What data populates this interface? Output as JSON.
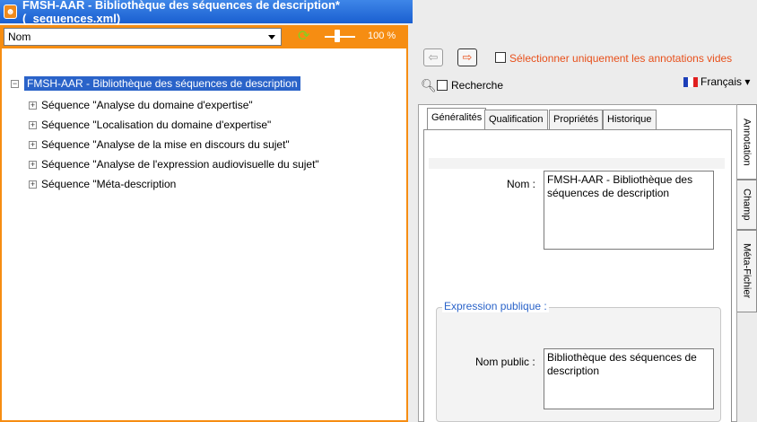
{
  "window": {
    "title": "FMSH-AAR - Bibliothèque des séquences de description* (_sequences.xml)",
    "app_icon": "cat-face-icon"
  },
  "left_toolbar": {
    "sort_select_value": "Nom",
    "refresh_icon": "refresh-icon",
    "zoom_label": "100 %",
    "zoom_fraction": 0.5
  },
  "tree": {
    "root": "FMSH-AAR - Bibliothèque des séquences de description",
    "items": [
      "Séquence \"Analyse du domaine d'expertise\"",
      "Séquence \"Localisation du domaine d'expertise\"",
      "Séquence \"Analyse de la mise en discours du sujet\"",
      "Séquence \"Analyse de l'expression audiovisuelle du sujet\"",
      "Séquence \"Méta-description"
    ]
  },
  "right_toolbar": {
    "back_icon": "arrow-left-icon",
    "forward_icon": "arrow-right-icon",
    "empty_only_label": "Sélectionner uniquement les annotations vides",
    "search_label": "Recherche",
    "language": "Français"
  },
  "tabs": [
    "Généralités",
    "Qualification",
    "Propriétés",
    "Historique"
  ],
  "side_tabs": [
    "Annotation",
    "Champ",
    "Méta-Fichier"
  ],
  "form": {
    "name_label": "Nom :",
    "name_value": "FMSH-AAR - Bibliothèque des séquences de description",
    "public_group_label": "Expression publique :",
    "public_name_label": "Nom public :",
    "public_name_value": "Bibliothèque des séquences de description"
  },
  "colors": {
    "accent": "#f68d12",
    "title_bar": "#2a6ee0",
    "selection": "#2a63c9",
    "warning_text": "#e8501b"
  }
}
